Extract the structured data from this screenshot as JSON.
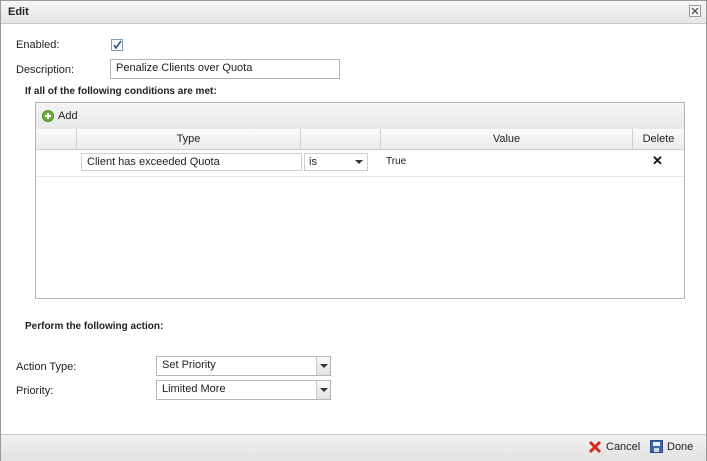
{
  "dialog": {
    "title": "Edit"
  },
  "form": {
    "enabled_label": "Enabled:",
    "enabled_checked": true,
    "description_label": "Description:",
    "description_value": "Penalize Clients over Quota"
  },
  "conditions": {
    "heading": "If all of the following conditions are met:",
    "add_label": "Add",
    "columns": {
      "type": "Type",
      "value": "Value",
      "delete": "Delete"
    },
    "rows": [
      {
        "type": "Client has exceeded Quota",
        "operator": "is",
        "value": "True",
        "delete_glyph": "✕"
      }
    ]
  },
  "action": {
    "heading": "Perform the following action:",
    "action_type_label": "Action Type:",
    "action_type_value": "Set Priority",
    "priority_label": "Priority:",
    "priority_value": "Limited More"
  },
  "footer": {
    "cancel_label": "Cancel",
    "done_label": "Done"
  },
  "icons": {
    "close": "close-icon",
    "check": "checkmark-icon",
    "add": "plus-circle-icon",
    "cancel": "red-x-icon",
    "done": "floppy-disk-icon"
  },
  "colors": {
    "add_green": "#6ab03a",
    "cancel_red": "#d42a1f",
    "done_blue": "#3f66a8"
  }
}
